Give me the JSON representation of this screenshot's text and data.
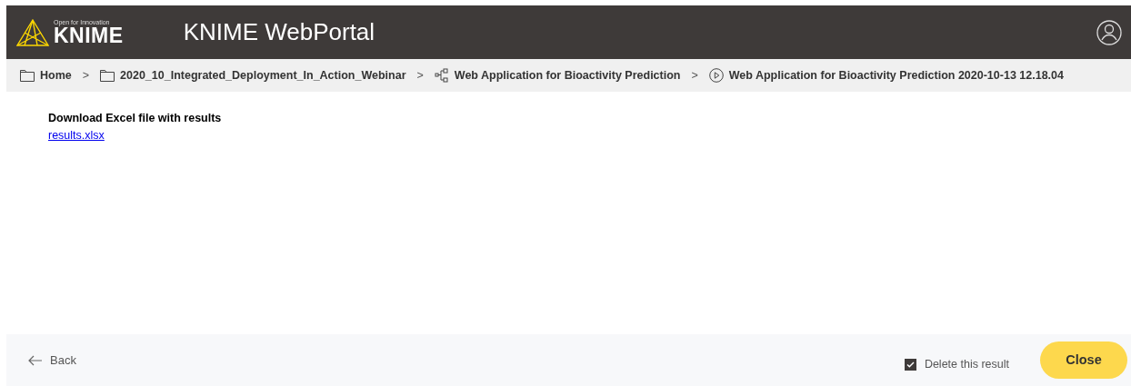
{
  "header": {
    "logo_tagline": "Open for Innovation",
    "logo_text": "KNIME",
    "title": "KNIME WebPortal"
  },
  "breadcrumb": [
    {
      "kind": "folder",
      "label": "Home"
    },
    {
      "kind": "folder",
      "label": "2020_10_Integrated_Deployment_In_Action_Webinar"
    },
    {
      "kind": "workflow",
      "label": "Web Application for Bioactivity Prediction"
    },
    {
      "kind": "job",
      "label": "Web Application for Bioactivity Prediction 2020-10-13 12.18.04"
    }
  ],
  "separator": ">",
  "content": {
    "heading": "Download Excel file with results",
    "link": "results.xlsx"
  },
  "footer": {
    "back": "Back",
    "delete_checkbox": {
      "label": "Delete this result",
      "checked": true
    },
    "close": "Close"
  }
}
